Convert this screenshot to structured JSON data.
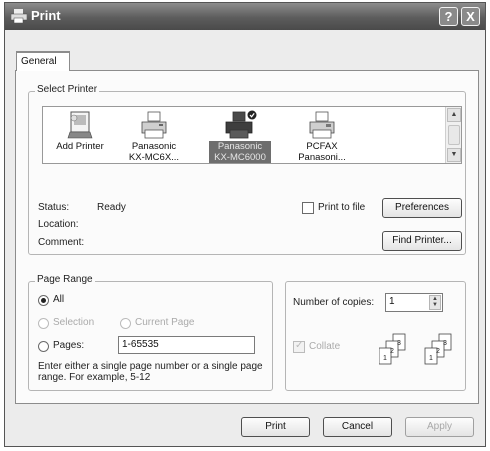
{
  "window": {
    "title": "Print",
    "help_button": "?",
    "close_button": "X"
  },
  "tabs": [
    {
      "label": "General"
    }
  ],
  "select_printer": {
    "label": "Select Printer",
    "printers": [
      {
        "name": "Add Printer",
        "icon": "add-printer-icon"
      },
      {
        "name": "Panasonic KX-MC6X...",
        "icon": "printer-icon"
      },
      {
        "name": "Panasonic KX-MC6000",
        "icon": "default-printer-icon",
        "selected": true
      },
      {
        "name": "PCFAX Panasoni...",
        "icon": "fax-printer-icon"
      }
    ],
    "status_label": "Status:",
    "status_value": "Ready",
    "location_label": "Location:",
    "location_value": "",
    "comment_label": "Comment:",
    "comment_value": "",
    "print_to_file_label": "Print to file",
    "preferences_button": "Preferences",
    "find_printer_button": "Find Printer..."
  },
  "page_range": {
    "label": "Page Range",
    "all_label": "All",
    "selection_label": "Selection",
    "current_page_label": "Current Page",
    "pages_label": "Pages:",
    "pages_value": "1-65535",
    "selected_option": "All",
    "hint": "Enter either a single page number or a single page range.  For example, 5-12"
  },
  "copies": {
    "number_of_copies_label": "Number of copies:",
    "number_of_copies_value": "1",
    "collate_label": "Collate",
    "collate_checked": true,
    "collate_enabled": false
  },
  "footer": {
    "print_button": "Print",
    "cancel_button": "Cancel",
    "apply_button": "Apply"
  },
  "colors": {
    "titlebar": "#5c5c5c",
    "selection": "#6e6e6e",
    "panel": "#fbfbfb"
  }
}
